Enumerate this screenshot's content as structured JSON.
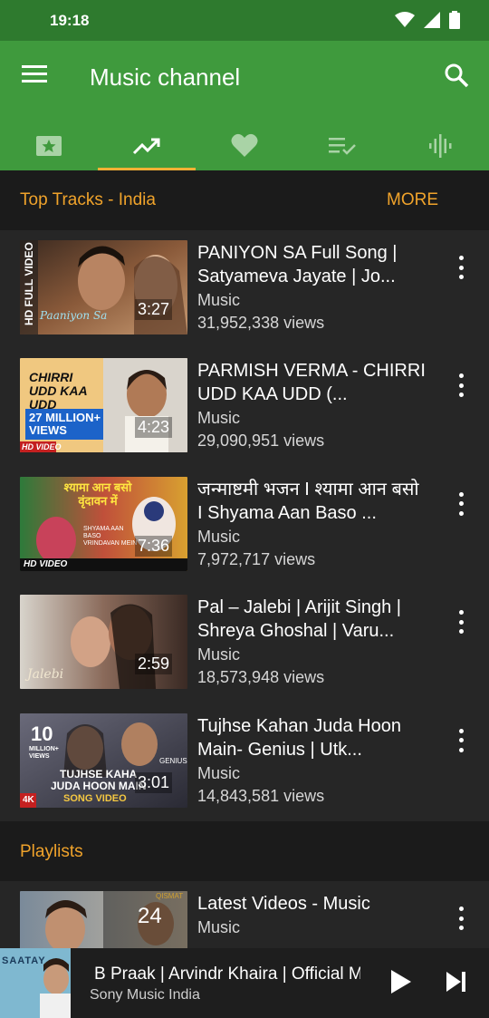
{
  "status": {
    "time": "19:18"
  },
  "app": {
    "title": "Music channel"
  },
  "tabs": [
    "featured",
    "trending",
    "favorites",
    "playlist",
    "live"
  ],
  "top_tracks": {
    "title": "Top Tracks - India",
    "more_label": "MORE",
    "items": [
      {
        "title": "PANIYON SA Full Song | Satyameva Jayate  | Jo...",
        "channel": "Music",
        "views": "31,952,338 views",
        "duration": "3:27"
      },
      {
        "title": "PARMISH VERMA - CHIRRI UDD KAA UDD (...",
        "channel": "Music",
        "views": "29,090,951 views",
        "duration": "4:23"
      },
      {
        "title": "जन्माष्टमी भजन I श्यामा आन बसो I Shyama Aan Baso ...",
        "channel": "Music",
        "views": "7,972,717 views",
        "duration": "7:36"
      },
      {
        "title": "Pal – Jalebi | Arijit Singh | Shreya Ghoshal | Varu...",
        "channel": "Music",
        "views": "18,573,948 views",
        "duration": "2:59"
      },
      {
        "title": "Tujhse Kahan Juda Hoon Main- Genius | Utk...",
        "channel": "Music",
        "views": "14,843,581 views",
        "duration": "3:01"
      }
    ]
  },
  "playlists": {
    "title": "Playlists",
    "items": [
      {
        "title": "Latest Videos - Music",
        "channel": "Music",
        "count": "24"
      }
    ]
  },
  "thumbnail_text": {
    "t1_side": "HD FULL VIDEO",
    "t1_script": "Paaniyon Sa",
    "t2_title": "CHIRRI UDD KAA UDD",
    "t2_badge": "27 MILLION+ VIEWS",
    "t2_hd": "HD VIDEO",
    "t3_hindi": "श्यामा आन बसो वृंदावन में",
    "t3_sub": "SHYAMA AAN BASO VRINDAVAN MEIN",
    "t3_hd": "HD VIDEO",
    "t4_script": "Jalebi",
    "t5_count": "10",
    "t5_million": "MILLION+ VIEWS",
    "t5_line1": "TUJHSE KAHA",
    "t5_line2": "JUDA HOON MAIN",
    "t5_song": "SONG VIDEO",
    "t5_genius": "GENIUS",
    "t5_4k": "4K",
    "p1_qismat": "QISMAT",
    "mini_saatay": "SAATAY"
  },
  "now_playing": {
    "title": "B Praak |  Arvindr Khaira | Official M",
    "channel": "Sony Music India"
  },
  "colors": {
    "toolbar": "#3f9a3d",
    "status_bar": "#2e7a2e",
    "accent": "#f0a32b",
    "tab_indicator": "#f2b035",
    "background": "#1b1b1b",
    "card": "#262626"
  }
}
